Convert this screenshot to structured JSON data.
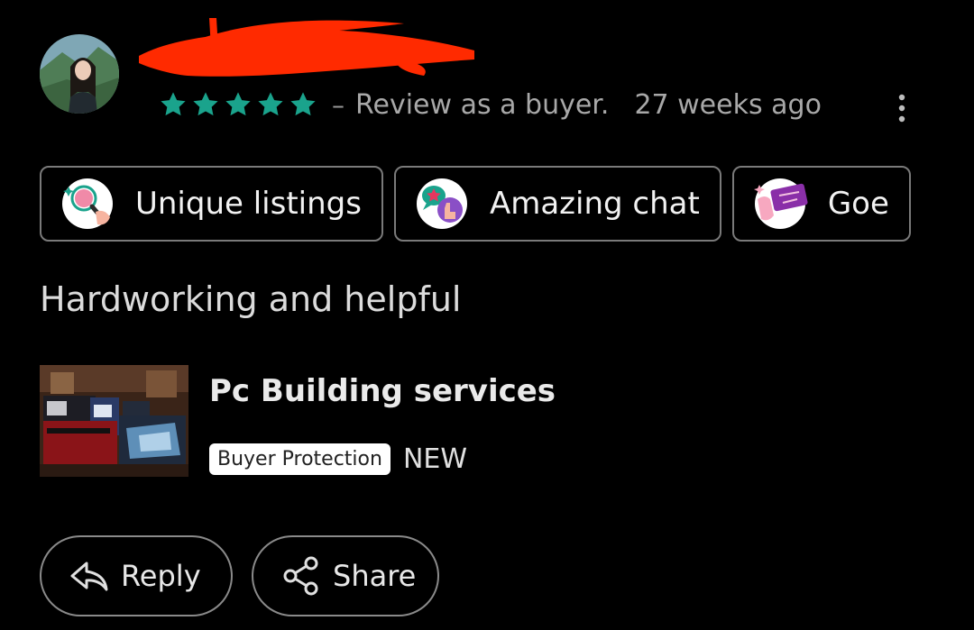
{
  "review": {
    "stars_filled": 5,
    "stars_total": 5,
    "dash": "–",
    "role": "Review as a buyer.",
    "time": "27 weeks ago",
    "text": "Hardworking and helpful"
  },
  "icons": {
    "avatar": "avatar-photo",
    "star": "star-icon",
    "more": "kebab-menu-icon",
    "reply": "reply-arrow-icon",
    "share": "share-nodes-icon"
  },
  "chips": [
    {
      "label": "Unique listings",
      "icon": "magnifier-icon"
    },
    {
      "label": "Amazing chat",
      "icon": "chat-bubble-icon"
    },
    {
      "label": "Goe",
      "icon": "ticket-icon"
    }
  ],
  "listing": {
    "title": "Pc Building services",
    "badge": "Buyer Protection",
    "condition": "NEW"
  },
  "actions": {
    "reply_label": "Reply",
    "share_label": "Share"
  },
  "colors": {
    "background": "#000000",
    "star": "#1aa38c",
    "redaction": "#ff2a00",
    "chip_border": "#7a7a7a",
    "badge_bg": "#ffffff"
  }
}
